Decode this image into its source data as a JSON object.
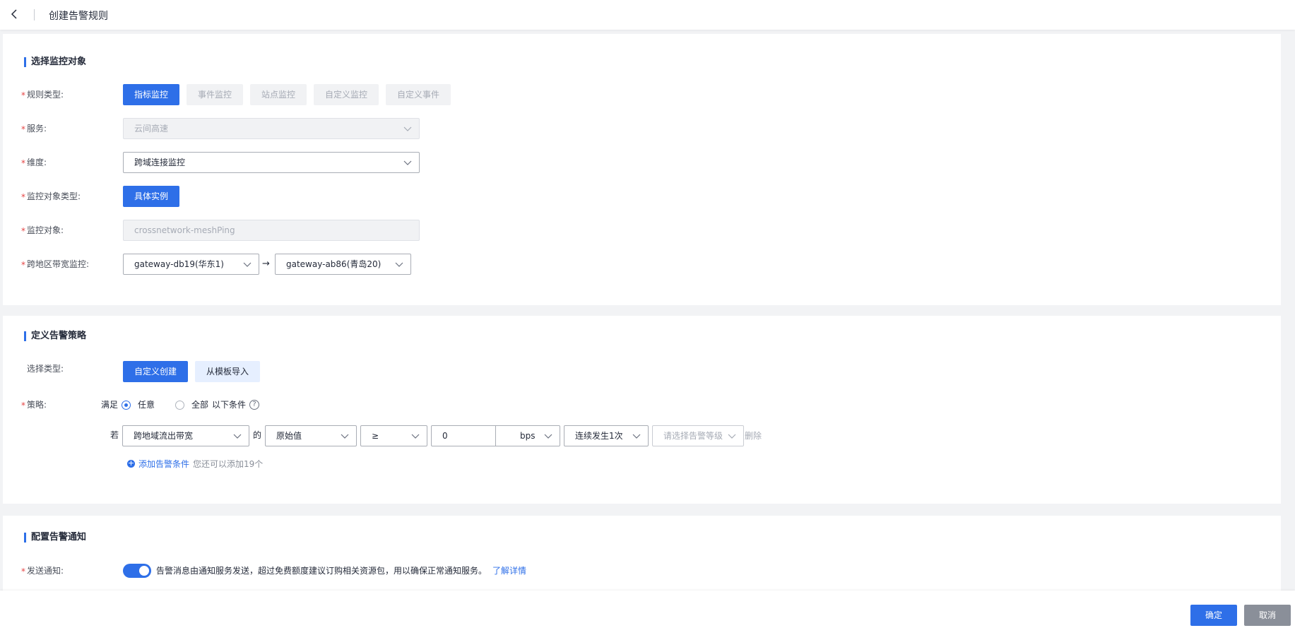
{
  "header": {
    "title": "创建告警规则"
  },
  "section1": {
    "title": "选择监控对象",
    "rule_type": {
      "label": "规则类型:",
      "options": [
        "指标监控",
        "事件监控",
        "站点监控",
        "自定义监控",
        "自定义事件"
      ],
      "selected": "指标监控"
    },
    "service": {
      "label": "服务:",
      "value": "云间高速"
    },
    "dimension": {
      "label": "维度:",
      "value": "跨域连接监控"
    },
    "object_type": {
      "label": "监控对象类型:",
      "value": "具体实例"
    },
    "object": {
      "label": "监控对象:",
      "value": "crossnetwork-meshPing"
    },
    "bandwidth": {
      "label": "跨地区带宽监控:",
      "from": "gateway-db19(华东1)",
      "arrow": "→",
      "to": "gateway-ab86(青岛20)"
    }
  },
  "section2": {
    "title": "定义告警策略",
    "select_type": {
      "label": "选择类型:",
      "options": [
        "自定义创建",
        "从模板导入"
      ],
      "selected": "自定义创建"
    },
    "strategy": {
      "label": "策略:",
      "prefix": "满足",
      "option_any": "任意",
      "option_all": "全部",
      "suffix": "以下条件",
      "help": "?"
    },
    "condition": {
      "if_label": "若",
      "metric": "跨地域流出带宽",
      "of_label": "的",
      "stat": "原始值",
      "operator": "≥",
      "threshold": "0",
      "unit": "bps",
      "frequency": "连续发生1次",
      "level_placeholder": "请选择告警等级",
      "delete_label": "删除"
    },
    "add_condition": {
      "label": "添加告警条件",
      "hint": "您还可以添加19个"
    }
  },
  "section3": {
    "title": "配置告警通知",
    "notify": {
      "label": "发送通知:",
      "enabled": true,
      "text": "告警消息由通知服务发送，超过免费额度建议订购相关资源包，用以确保正常通知服务。",
      "link": "了解详情"
    }
  },
  "footer": {
    "confirm": "确定",
    "cancel": "取消"
  },
  "colors": {
    "primary": "#2e6fe8",
    "required": "#e54545"
  }
}
